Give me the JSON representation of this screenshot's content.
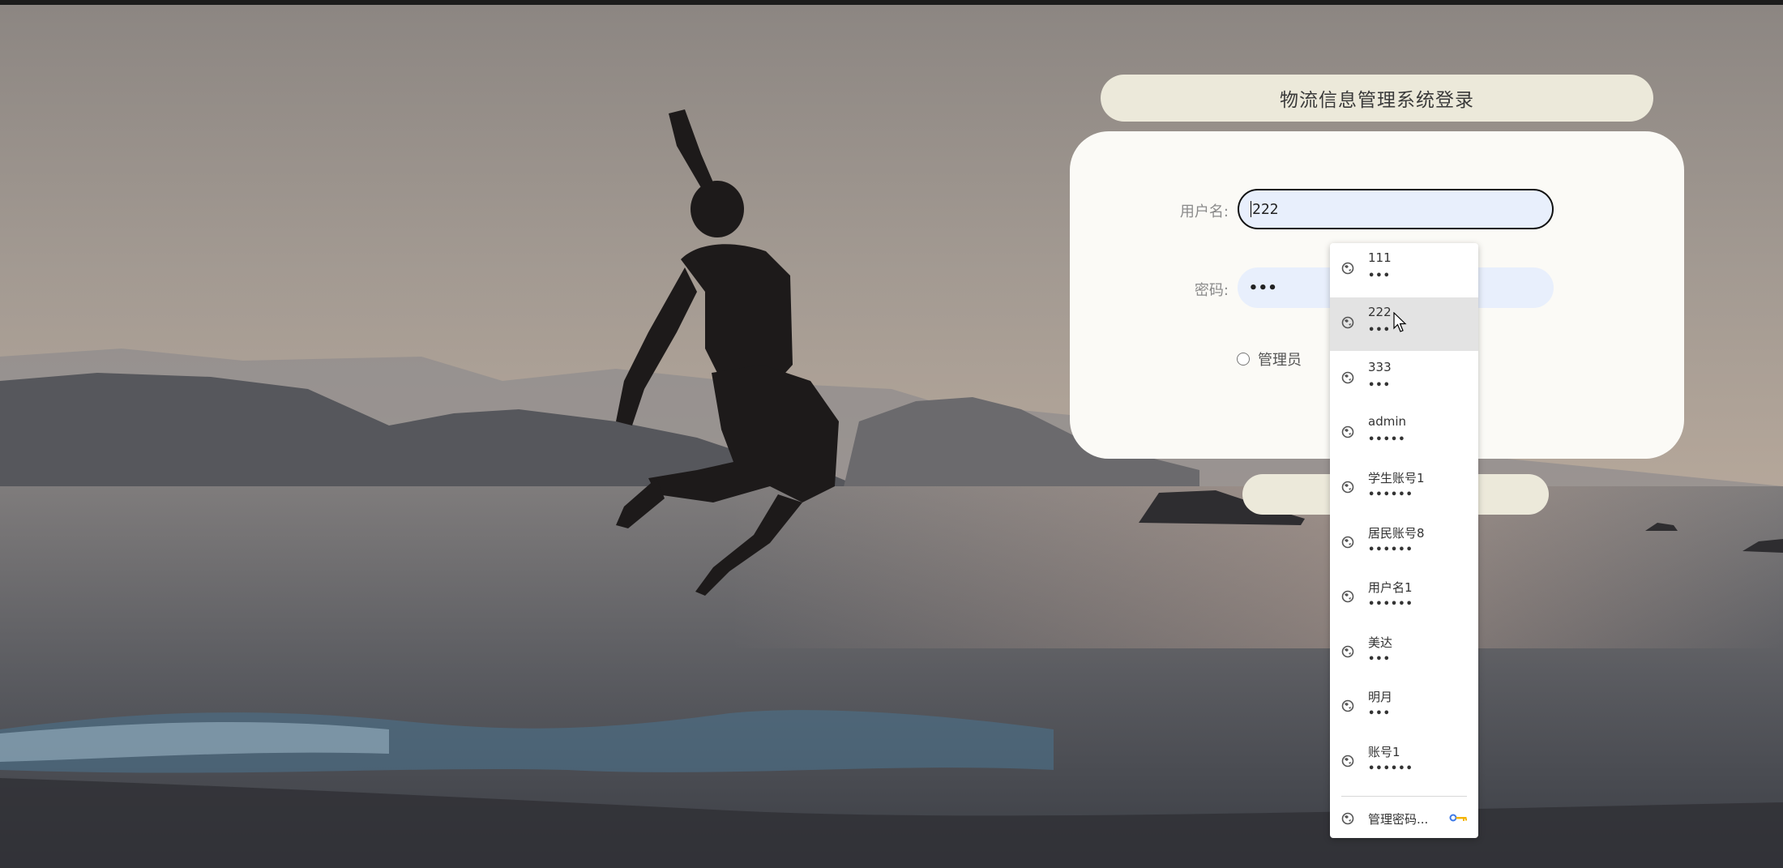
{
  "page": {
    "title": "物流信息管理系统登录"
  },
  "form": {
    "username_label": "用户名:",
    "username_value": "222",
    "password_label": "密码:",
    "password_value": "•••",
    "role_label": "管理员"
  },
  "autofill": {
    "entries": [
      {
        "username": "111",
        "password": "•••"
      },
      {
        "username": "222",
        "password": "•••"
      },
      {
        "username": "333",
        "password": "•••"
      },
      {
        "username": "admin",
        "password": "•••••"
      },
      {
        "username": "学生账号1",
        "password": "••••••"
      },
      {
        "username": "居民账号8",
        "password": "••••••"
      },
      {
        "username": "用户名1",
        "password": "••••••"
      },
      {
        "username": "美达",
        "password": "•••"
      },
      {
        "username": "明月",
        "password": "•••"
      },
      {
        "username": "账号1",
        "password": "••••••"
      }
    ],
    "highlighted_index": 1,
    "manage_label": "管理密码..."
  },
  "icons": {
    "entry_icon": "globe-icon",
    "manage_icon": "globe-icon",
    "key_icon": "key-icon",
    "cursor": "mouse-pointer-icon"
  },
  "colors": {
    "title_pill": "#ece9da",
    "card": "#fbfaf6",
    "input_fill": "#e8effc"
  }
}
